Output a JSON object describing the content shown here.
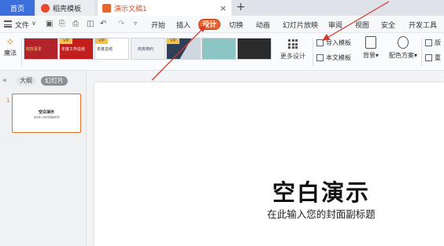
{
  "tabs": {
    "home": "首页",
    "templates": "稻壳模板",
    "document": "演示文稿1",
    "close_glyph": "×",
    "add_glyph": "+"
  },
  "menu": {
    "file": "文件",
    "items": [
      "开始",
      "插入",
      "设计",
      "切换",
      "动画",
      "幻灯片放映",
      "审阅",
      "视图",
      "安全",
      "开发工具"
    ],
    "active": "设计"
  },
  "ribbon": {
    "magic": "魔法",
    "vip_label": "VIP",
    "template_thumbs": [
      {
        "label": "欢庆喜年",
        "color": "#b3242a",
        "vip": false
      },
      {
        "label": "年度工作总结",
        "color": "#c21e1e",
        "vip": true
      },
      {
        "label": "年度总结",
        "color": "#ffffff",
        "vip": true
      },
      {
        "label": "商务简约",
        "color": "#eef1f3",
        "vip": false
      },
      {
        "label": "",
        "color": "#2f3f57",
        "vip": true
      },
      {
        "label": "",
        "color": "#8cc6c4",
        "vip": false
      },
      {
        "label": "",
        "color": "#2b2b2b",
        "vip": false
      }
    ],
    "more_design": "更多设计",
    "import_template": "导入模板",
    "text_template": "本文模板",
    "background": "背景",
    "color_scheme": "配色方案",
    "right_top": "版",
    "right_bottom": "重"
  },
  "panel": {
    "outline": "大纲",
    "slides": "幻灯片",
    "slide_number": "1",
    "thumb_title": "空白演示",
    "thumb_subtitle": "在此输入您的封面副标题"
  },
  "slide": {
    "title": "空白演示",
    "subtitle": "在此输入您的封面副标题"
  },
  "colors": {
    "accent": "#e8652f",
    "home_tab": "#3b6fdc",
    "arrow": "#d63b2a"
  }
}
